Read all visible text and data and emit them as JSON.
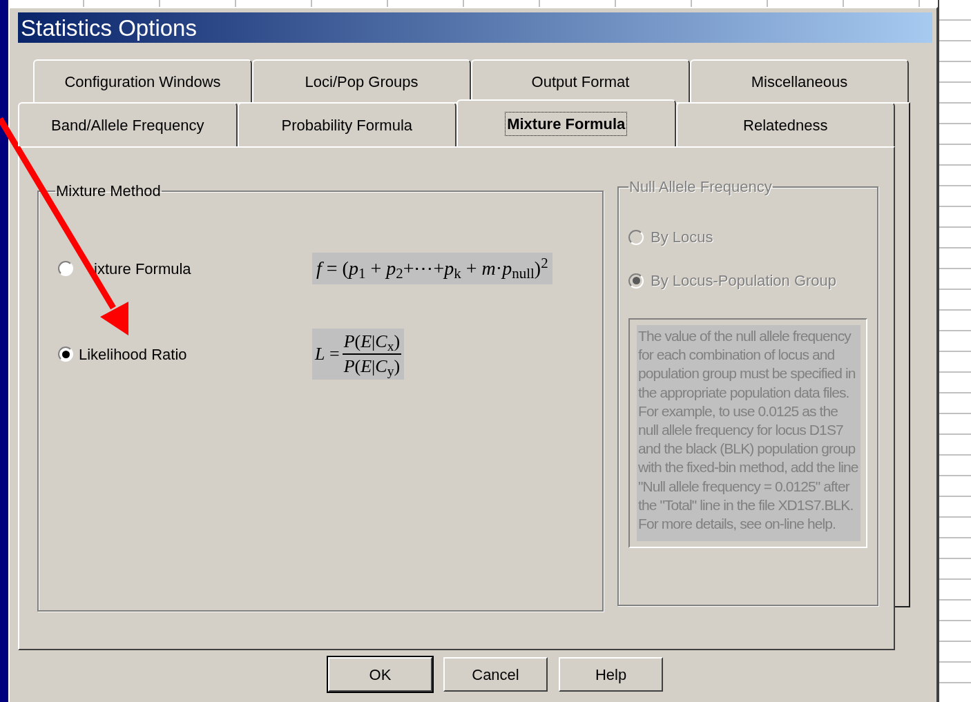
{
  "window": {
    "title": "Statistics Options"
  },
  "tab_rows": [
    {
      "tabs": [
        {
          "label": "Configuration Windows",
          "selected": false
        },
        {
          "label": "Loci/Pop Groups",
          "selected": false
        },
        {
          "label": "Output Format",
          "selected": false
        },
        {
          "label": "Miscellaneous",
          "selected": false
        }
      ]
    },
    {
      "tabs": [
        {
          "label": "Band/Allele Frequency",
          "selected": false
        },
        {
          "label": "Probability Formula",
          "selected": false
        },
        {
          "label": "Mixture Formula",
          "selected": true
        },
        {
          "label": "Relatedness",
          "selected": false
        }
      ]
    }
  ],
  "mixture_method": {
    "title": "Mixture Method",
    "options": [
      {
        "label": "ixture Formula",
        "selected": false,
        "formula": {
          "kind": "inline",
          "text": "*f* = (*p*$_{1}$ + *p*$_{2}$+⋯+*p*$_{k}$ + *m*·*p*$_{null}$)$^{2}$"
        }
      },
      {
        "label": "Likelihood Ratio",
        "selected": true,
        "formula": {
          "kind": "fraction",
          "lhs": "*L* =",
          "numerator": "*P*(*E*|*C*$_{x}$)",
          "denominator": "*P*(*E*|*C*$_{y}$)"
        }
      }
    ]
  },
  "null_allele_frequency": {
    "title": "Null Allele Frequency",
    "disabled": true,
    "options": [
      {
        "label": "By Locus",
        "selected": false
      },
      {
        "label": "By Locus-Population Group",
        "selected": true
      }
    ],
    "note": "The value of the null allele frequency for each combination of locus and population group must be specified in the appropriate population data files. For example, to use 0.0125 as the null allele frequency for locus D1S7 and the black (BLK) population group with the fixed-bin method, add the line \"Null allele frequency = 0.0125\" after the \"Total\" line in the file XD1S7.BLK.  For more details, see on-line help."
  },
  "buttons": [
    {
      "label": "OK",
      "default": true
    },
    {
      "label": "Cancel",
      "default": false
    },
    {
      "label": "Help",
      "default": false
    }
  ]
}
